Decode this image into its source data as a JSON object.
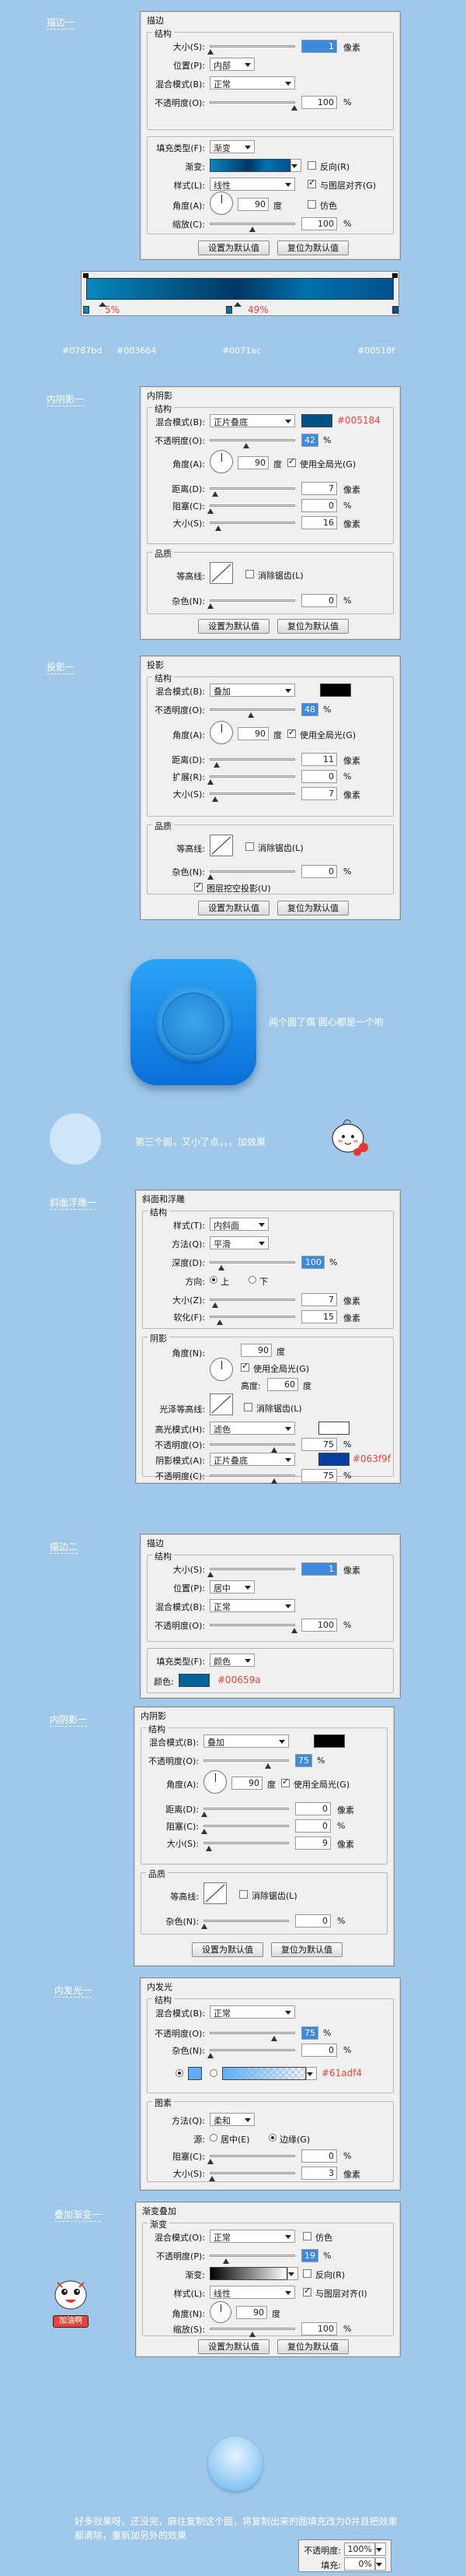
{
  "s1": {
    "caption": "描边一",
    "panel_title": "描边",
    "structure": "结构",
    "size_label": "大小(S):",
    "size_value": "1",
    "px": "像素",
    "position_label": "位置(P):",
    "position_value": "内部",
    "blend_label": "混合模式(B):",
    "blend_value": "正常",
    "opacity_label": "不透明度(O):",
    "opacity_value": "100",
    "pct": "%",
    "filltype_label": "填充类型(F):",
    "filltype_value": "渐变",
    "gradient_label": "渐变:",
    "reverse_label": "反向(R)",
    "style_label": "样式(L):",
    "style_value": "线性",
    "align_label": "与图层对齐(G)",
    "angle_label": "角度(A):",
    "angle_value": "90",
    "degree": "度",
    "dither_label": "仿色",
    "scale_label": "缩放(C):",
    "scale_value": "100",
    "btn_default": "设置为默认值",
    "btn_reset": "复位为默认值",
    "pct5": "5%",
    "pct49": "49%",
    "hex1": "#0787bd",
    "hex2": "#003664",
    "hex3": "#0071ac",
    "hex4": "#00518f"
  },
  "s2": {
    "caption": "内阴影一",
    "panel_title": "内阴影",
    "structure": "结构",
    "blend_label": "混合模式(B):",
    "blend_value": "正片叠底",
    "hex": "#005184",
    "opacity_label": "不透明度(O):",
    "opacity_value": "42",
    "angle_label": "角度(A):",
    "angle_value": "90",
    "degree": "度",
    "global_label": "使用全局光(G)",
    "distance_label": "距离(D):",
    "distance_value": "7",
    "choke_label": "阻塞(C):",
    "choke_value": "0",
    "size_label": "大小(S):",
    "size_value": "16",
    "px": "像素",
    "pct": "%",
    "quality": "品质",
    "contour_label": "等高线:",
    "antialias_label": "消除锯齿(L)",
    "noise_label": "杂色(N):",
    "noise_value": "0",
    "btn_default": "设置为默认值",
    "btn_reset": "复位为默认值"
  },
  "s3": {
    "caption": "投影一",
    "panel_title": "投影",
    "structure": "结构",
    "blend_label": "混合模式(B):",
    "blend_value": "叠加",
    "opacity_label": "不透明度(O):",
    "opacity_value": "48",
    "angle_label": "角度(A):",
    "angle_value": "90",
    "degree": "度",
    "global_label": "使用全局光(G)",
    "distance_label": "距离(D):",
    "distance_value": "11",
    "spread_label": "扩展(R):",
    "spread_value": "0",
    "size_label": "大小(S):",
    "size_value": "7",
    "px": "像素",
    "pct": "%",
    "quality": "品质",
    "contour_label": "等高线:",
    "antialias_label": "消除锯齿(L)",
    "noise_label": "杂色(N):",
    "noise_value": "0",
    "knockout_label": "图层挖空投影(U)",
    "btn_default": "设置为默认值",
    "btn_reset": "复位为默认值"
  },
  "icon_note": "两个圆了偶 圆心都是一个哟",
  "circle_note": "第三个圆，又小了点，，，加效果",
  "s4": {
    "caption": "斜面浮雕一",
    "panel_title": "斜面和浮雕",
    "structure": "结构",
    "style_label": "样式(T):",
    "style_value": "内斜面",
    "method_label": "方法(Q):",
    "method_value": "平滑",
    "depth_label": "深度(D):",
    "depth_value": "100",
    "direction_label": "方向:",
    "up_label": "上",
    "down_label": "下",
    "size_label": "大小(Z):",
    "size_value": "7",
    "soften_label": "软化(F):",
    "soften_value": "15",
    "px": "像素",
    "pct": "%",
    "shading": "阴影",
    "angle_label": "角度(N):",
    "angle_value": "90",
    "degree": "度",
    "global_label": "使用全局光(G)",
    "altitude_label": "高度:",
    "altitude_value": "60",
    "gloss_label": "光泽等高线:",
    "antialias_label": "消除锯齿(L)",
    "highlight_label": "高光模式(H):",
    "highlight_value": "滤色",
    "hl_opacity_label": "不透明度(O):",
    "hl_opacity_value": "75",
    "shadow_label": "阴影模式(A):",
    "shadow_value": "正片叠底",
    "hex": "#063f9f",
    "sh_opacity_label": "不透明度(C):",
    "sh_opacity_value": "75"
  },
  "s5": {
    "caption": "描边二",
    "panel_title": "描边",
    "structure": "结构",
    "size_label": "大小(S):",
    "size_value": "1",
    "px": "像素",
    "position_label": "位置(P):",
    "position_value": "居中",
    "blend_label": "混合模式(B):",
    "blend_value": "正常",
    "opacity_label": "不透明度(O):",
    "opacity_value": "100",
    "pct": "%",
    "filltype_label": "填充类型(F):",
    "filltype_value": "颜色",
    "color_label": "颜色:",
    "hex": "#00659a"
  },
  "s6": {
    "caption": "内阴影一",
    "panel_title": "内阴影",
    "structure": "结构",
    "blend_label": "混合模式(B):",
    "blend_value": "叠加",
    "opacity_label": "不透明度(O):",
    "opacity_value": "75",
    "angle_label": "角度(A):",
    "angle_value": "90",
    "degree": "度",
    "global_label": "使用全局光(G)",
    "distance_label": "距离(D):",
    "distance_value": "0",
    "choke_label": "阻塞(C):",
    "choke_value": "0",
    "size_label": "大小(S):",
    "size_value": "9",
    "px": "像素",
    "pct": "%",
    "quality": "品质",
    "contour_label": "等高线:",
    "antialias_label": "消除锯齿(L)",
    "noise_label": "杂色(N):",
    "noise_value": "0",
    "btn_default": "设置为默认值",
    "btn_reset": "复位为默认值"
  },
  "s7": {
    "caption": "内发光一",
    "panel_title": "内发光",
    "structure": "结构",
    "blend_label": "混合模式(B):",
    "blend_value": "正常",
    "opacity_label": "不透明度(O):",
    "opacity_value": "75",
    "noise_label": "杂色(N):",
    "noise_value": "0",
    "pct": "%",
    "hex": "#61adf4",
    "elements": "图素",
    "method_label": "方法(Q):",
    "method_value": "柔和",
    "source_label": "源:",
    "center_label": "居中(E)",
    "edge_label": "边缘(G)",
    "choke_label": "阻塞(C):",
    "choke_value": "0",
    "size_label": "大小(S):",
    "size_value": "3",
    "px": "像素"
  },
  "s8": {
    "caption": "叠加渐变一",
    "panel_title": "渐变叠加",
    "sub": "渐变",
    "blend_label": "混合模式(O):",
    "blend_value": "正常",
    "dither_label": "仿色",
    "opacity_label": "不透明度(P):",
    "opacity_value": "19",
    "gradient_label": "渐变:",
    "reverse_label": "反向(R)",
    "style_label": "样式(L):",
    "style_value": "线性",
    "align_label": "与图层对齐(I)",
    "angle_label": "角度(N):",
    "angle_value": "90",
    "degree": "度",
    "scale_label": "缩放(S):",
    "scale_value": "100",
    "pct": "%",
    "btn_default": "设置为默认值",
    "btn_reset": "复位为默认值",
    "sticker": "加油啊"
  },
  "footer": {
    "note": "好多效果呀，还没完，麻住复制这个圆，将复制出来的圆填充改为0并且把效果都清除，重新加另外的效果",
    "opacity_label": "不透明度:",
    "opacity_value": "100%",
    "fill_label": "填充:",
    "fill_value": "0%"
  },
  "colors": {
    "background": "#9fc8ea",
    "icon_blue": "#1a8ff0",
    "annotation_red": "#e8443a",
    "swatch_s2": "#005184",
    "swatch_s4": "#063f9f",
    "swatch_s5": "#00659a",
    "swatch_s7": "#61adf4"
  }
}
